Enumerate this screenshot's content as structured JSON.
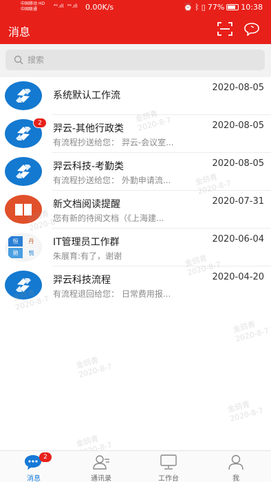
{
  "status_bar": {
    "carrier_1": "中国移动",
    "carrier_1_tag": "HD",
    "carrier_2": "中国联通",
    "signal_1": "⁴ᴳ.ıll",
    "signal_2": "⁴ᴳ.ıll",
    "net_speed": "0.00K/s",
    "battery": "77%",
    "time": "10:38"
  },
  "header": {
    "title": "消息"
  },
  "search": {
    "placeholder": "搜索"
  },
  "conversations": [
    {
      "name": "系统默认工作流",
      "date": "2020-08-05",
      "preview": "",
      "avatar": "flow-logo",
      "badge": ""
    },
    {
      "name": "羿云-其他行政类",
      "date": "2020-08-05",
      "preview": "有流程抄送给您： 羿云-会议室...",
      "avatar": "flow-logo",
      "badge": "2"
    },
    {
      "name": "羿云科技-考勤类",
      "date": "2020-08-05",
      "preview": "有流程抄送给您： 外勤申请流...",
      "avatar": "flow-logo",
      "badge": ""
    },
    {
      "name": "新文档阅读提醒",
      "date": "2020-07-31",
      "preview": "您有新的待阅文档（《上海建...",
      "avatar": "book-icon",
      "badge": ""
    },
    {
      "name": "IT管理员工作群",
      "date": "2020-06-04",
      "preview": "朱展育:有了，谢谢",
      "avatar": "group-avatar",
      "badge": "",
      "group_members": [
        "恒",
        "丹",
        "驰",
        "悦"
      ]
    },
    {
      "name": "羿云科技流程",
      "date": "2020-04-20",
      "preview": "有流程退回给您： 日常费用报...",
      "avatar": "flow-logo",
      "badge": ""
    }
  ],
  "watermark": {
    "name": "金鸱青",
    "date": "2020-8-7"
  },
  "tab_bar": {
    "tabs": [
      {
        "label": "消息",
        "icon": "chat-bubble-icon",
        "badge": "2",
        "active": true
      },
      {
        "label": "通讯录",
        "icon": "contacts-icon",
        "badge": "",
        "active": false
      },
      {
        "label": "工作台",
        "icon": "monitor-icon",
        "badge": "",
        "active": false
      },
      {
        "label": "我",
        "icon": "person-icon",
        "badge": "",
        "active": false
      }
    ]
  },
  "colors": {
    "brand_red": "#e8201a",
    "flow_blue": "#1479d0",
    "doc_orange": "#e0502a",
    "active_tab_blue": "#1679d6"
  }
}
